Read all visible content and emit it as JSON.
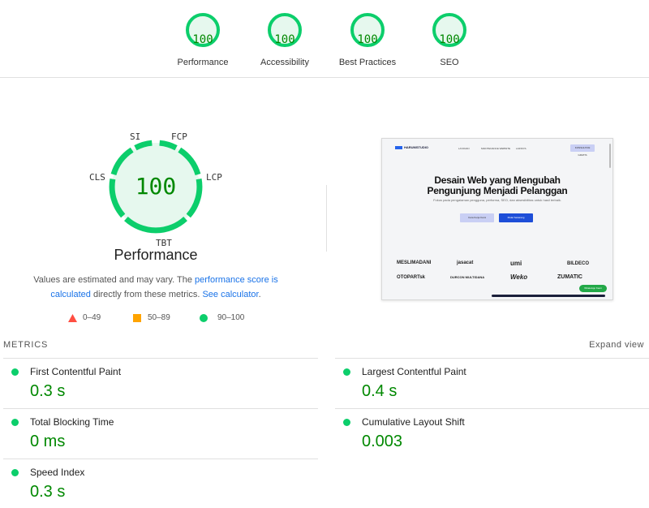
{
  "gauges": [
    {
      "label": "Performance",
      "score": "100"
    },
    {
      "label": "Accessibility",
      "score": "100"
    },
    {
      "label": "Best Practices",
      "score": "100"
    },
    {
      "label": "SEO",
      "score": "100"
    }
  ],
  "performance": {
    "score": "100",
    "title": "Performance",
    "segments": {
      "si": "SI",
      "fcp": "FCP",
      "lcp": "LCP",
      "tbt": "TBT",
      "cls": "CLS"
    },
    "desc_part1": "Values are estimated and may vary. The ",
    "desc_link1": "performance score is calculated",
    "desc_part2": " directly from these metrics. ",
    "desc_link2": "See calculator",
    "desc_part3": "."
  },
  "legend": {
    "fail": "0–49",
    "average": "50–89",
    "pass": "90–100"
  },
  "colors": {
    "pass": "#0cce6b",
    "pass_text": "#008800",
    "average": "#ffa400",
    "fail": "#ff4e42",
    "link": "#1a73e8"
  },
  "thumbnail": {
    "brand": "HARUMSTUDIO",
    "nav_links": [
      "LAYANAN",
      "MAINTENANCE WEBSITE",
      "LAINNYA"
    ],
    "nav_button": "KONSULTASI GRATIS",
    "headline1": "Desain Web yang Mengubah",
    "headline2": "Pengunjung Menjadi Pelanggan",
    "subtitle": "Fokus pada pengalaman pengguna, performa, SEO, dan aksesibilitas untuk hasil terbaik.",
    "btn_secondary": "Cara Kerja Kami",
    "btn_primary": "Mulai Sekarang",
    "clients": [
      "MESLIMADANI",
      "jasacat",
      "umi",
      "BILDECO",
      "OTOPARTsk",
      "DURCON MULTIDANA",
      "Weko",
      "ZUMATIC"
    ],
    "whatsapp": "WhatsApp Kami"
  },
  "metrics": {
    "heading": "METRICS",
    "expand": "Expand view",
    "items": [
      {
        "label": "First Contentful Paint",
        "value": "0.3 s"
      },
      {
        "label": "Largest Contentful Paint",
        "value": "0.4 s"
      },
      {
        "label": "Total Blocking Time",
        "value": "0 ms"
      },
      {
        "label": "Cumulative Layout Shift",
        "value": "0.003"
      },
      {
        "label": "Speed Index",
        "value": "0.3 s"
      }
    ]
  }
}
